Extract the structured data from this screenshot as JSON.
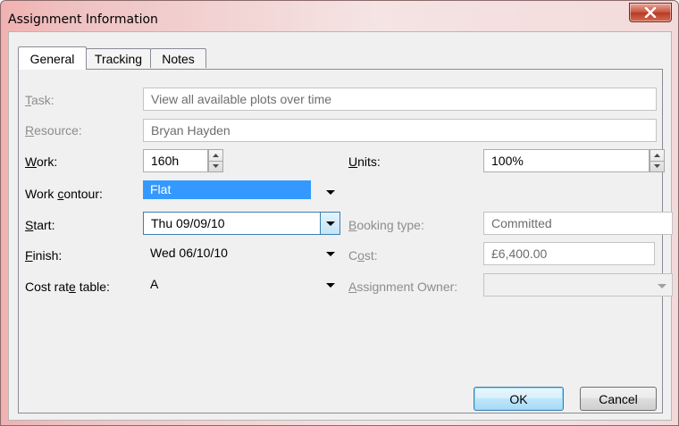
{
  "window": {
    "title": "Assignment Information",
    "close_icon": "close-icon"
  },
  "tabs": [
    {
      "label": "General",
      "active": true
    },
    {
      "label": "Tracking",
      "active": false
    },
    {
      "label": "Notes",
      "active": false
    }
  ],
  "form": {
    "task": {
      "label": "Task:",
      "value": "View all available plots over time"
    },
    "resource": {
      "label": "Resource:",
      "value": "Bryan Hayden"
    },
    "work": {
      "label": "Work:",
      "value": "160h"
    },
    "units": {
      "label": "Units:",
      "value": "100%"
    },
    "work_contour": {
      "label": "Work contour:",
      "value": "Flat"
    },
    "start": {
      "label": "Start:",
      "value": "Thu 09/09/10"
    },
    "booking_type": {
      "label": "Booking type:",
      "value": "Committed"
    },
    "finish": {
      "label": "Finish:",
      "value": "Wed 06/10/10"
    },
    "cost": {
      "label": "Cost:",
      "value": "£6,400.00"
    },
    "cost_rate_table": {
      "label": "Cost rate table:",
      "value": "A"
    },
    "assignment_owner": {
      "label": "Assignment Owner:",
      "value": ""
    }
  },
  "buttons": {
    "ok": "OK",
    "cancel": "Cancel"
  },
  "colors": {
    "selection": "#3399ff",
    "title_bg": "#efc2c2",
    "disabled_text": "#8d8d8d"
  }
}
